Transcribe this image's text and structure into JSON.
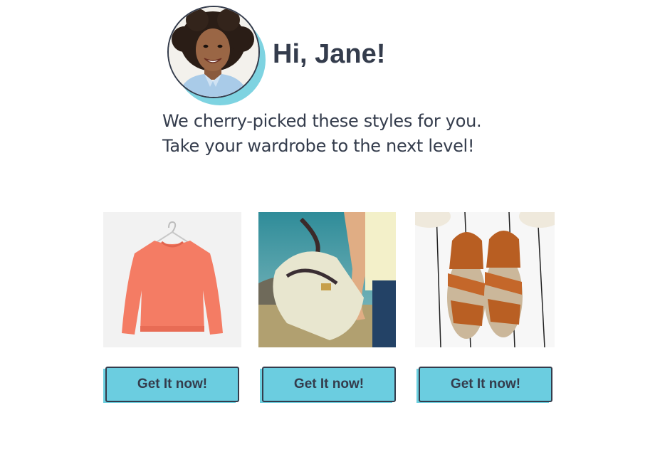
{
  "header": {
    "greeting": "Hi, Jane!",
    "intro_line_1": "We cherry-picked these styles for you.",
    "intro_line_2": "Take your wardrobe to the next level!"
  },
  "products": [
    {
      "image": "coral-sweater-photo",
      "button_label": "Get It now!"
    },
    {
      "image": "canvas-tote-bag-photo",
      "button_label": "Get It now!"
    },
    {
      "image": "tan-espadrille-sandals-photo",
      "button_label": "Get It now!"
    }
  ],
  "colors": {
    "text": "#343c4c",
    "accent": "#6bcde0",
    "accent_shadow": "#7ed3e1",
    "background": "#ffffff"
  }
}
